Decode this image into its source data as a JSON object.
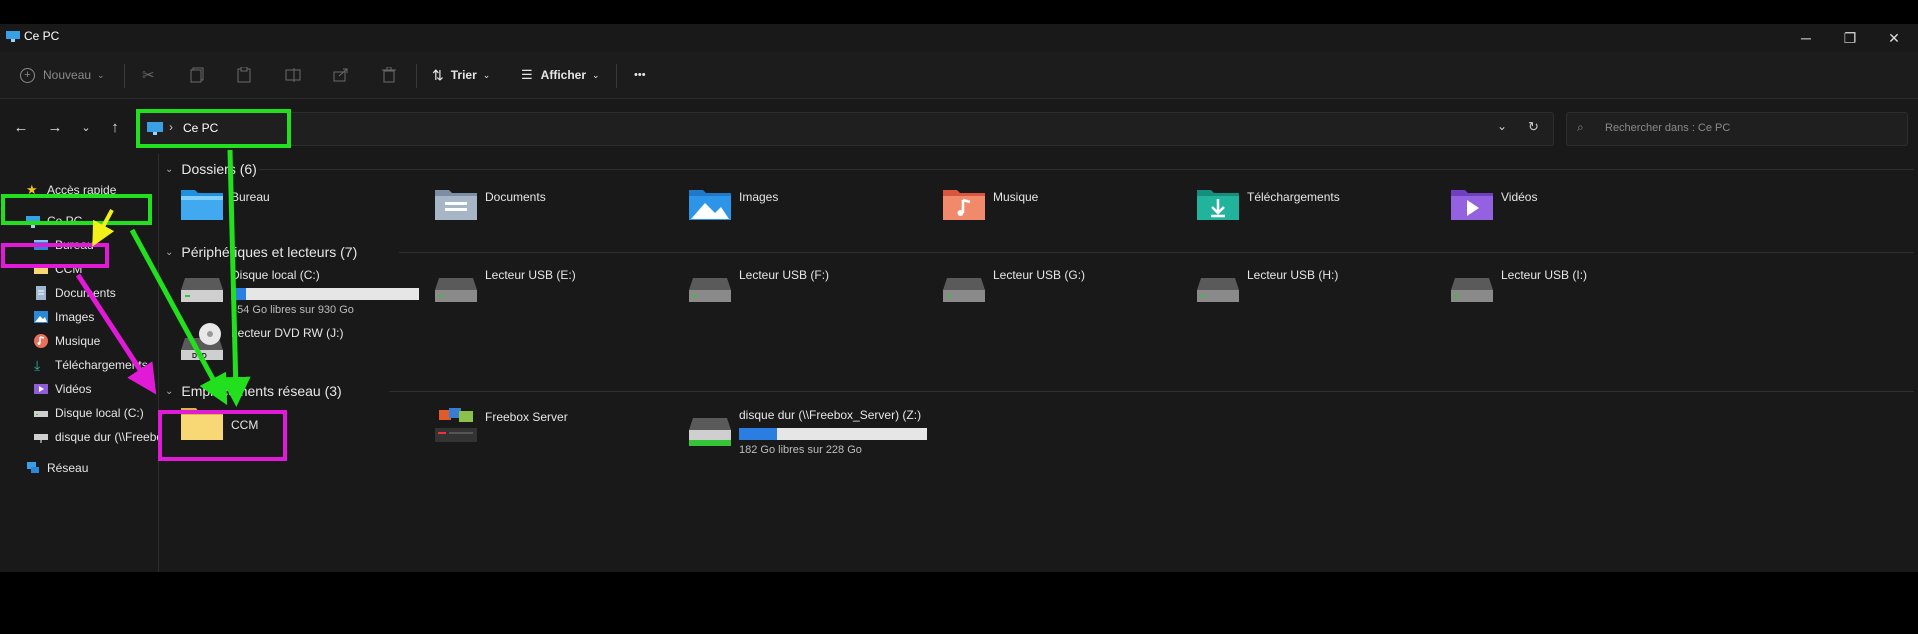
{
  "window": {
    "title": "Ce PC"
  },
  "commands": {
    "new_label": "Nouveau",
    "sort_label": "Trier",
    "view_label": "Afficher",
    "more_label": "•••"
  },
  "address": {
    "crumb_sep": "›",
    "location": "Ce PC"
  },
  "search": {
    "placeholder": "Rechercher dans : Ce PC"
  },
  "sidebar": {
    "quick_access": "Accès rapide",
    "this_pc": "Ce PC",
    "items": [
      "Bureau",
      "CCM",
      "Documents",
      "Images",
      "Musique",
      "Téléchargements",
      "Vidéos",
      "Disque local (C:)",
      "disque dur (\\\\Freebox_Server) (Z:)"
    ],
    "network": "Réseau"
  },
  "sections": {
    "folders": "Dossiers (6)",
    "devices": "Périphériques et lecteurs (7)",
    "network": "Emplacements réseau (3)"
  },
  "folders": [
    "Bureau",
    "Documents",
    "Images",
    "Musique",
    "Téléchargements",
    "Vidéos"
  ],
  "devices": {
    "local": {
      "name": "Disque local (C:)",
      "free": "854 Go libres sur 930 Go",
      "used_fraction": 0.08
    },
    "usb": [
      "Lecteur USB (E:)",
      "Lecteur USB (F:)",
      "Lecteur USB (G:)",
      "Lecteur USB (H:)",
      "Lecteur USB (I:)"
    ],
    "dvd": {
      "name": "Lecteur DVD RW (J:)",
      "badge": "DVD"
    }
  },
  "network_locations": {
    "ccm": "CCM",
    "freebox": "Freebox Server",
    "disk": {
      "name": "disque dur (\\\\Freebox_Server) (Z:)",
      "free": "182 Go libres sur 228 Go",
      "used_fraction": 0.2
    }
  },
  "colors": {
    "window_bg": "#191919",
    "annotation_green": "#22e01d",
    "annotation_magenta": "#e11ad8",
    "annotation_yellow": "#f2f21a",
    "drive_bar": "#2a7de1"
  }
}
